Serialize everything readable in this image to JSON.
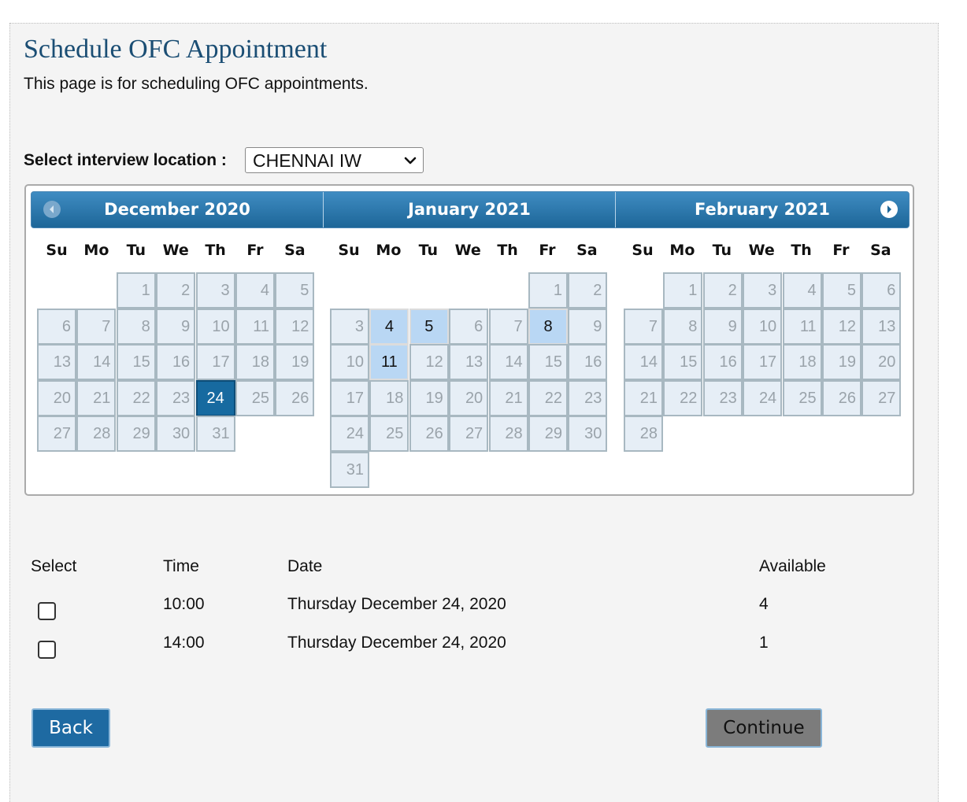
{
  "page": {
    "title": "Schedule OFC Appointment",
    "subtitle": "This page is for scheduling OFC appointments."
  },
  "location": {
    "label": "Select interview location :",
    "selected": "CHENNAI IW"
  },
  "calendar": {
    "prev_icon": "chevron-left-circle-icon",
    "next_icon": "chevron-right-circle-icon",
    "weekdays": [
      "Su",
      "Mo",
      "Tu",
      "We",
      "Th",
      "Fr",
      "Sa"
    ],
    "months": [
      {
        "title": "December 2020",
        "first_weekday": 2,
        "days": 31,
        "available": [],
        "selected": 24
      },
      {
        "title": "January 2021",
        "first_weekday": 5,
        "days": 31,
        "available": [
          4,
          5,
          8,
          11
        ],
        "selected": null
      },
      {
        "title": "February 2021",
        "first_weekday": 1,
        "days": 28,
        "available": [],
        "selected": null
      }
    ]
  },
  "slots": {
    "headers": {
      "select": "Select",
      "time": "Time",
      "date": "Date",
      "available": "Available"
    },
    "rows": [
      {
        "time": "10:00",
        "date": "Thursday December 24, 2020",
        "available": "4"
      },
      {
        "time": "14:00",
        "date": "Thursday December 24, 2020",
        "available": "1"
      }
    ]
  },
  "buttons": {
    "back": "Back",
    "continue": "Continue"
  }
}
